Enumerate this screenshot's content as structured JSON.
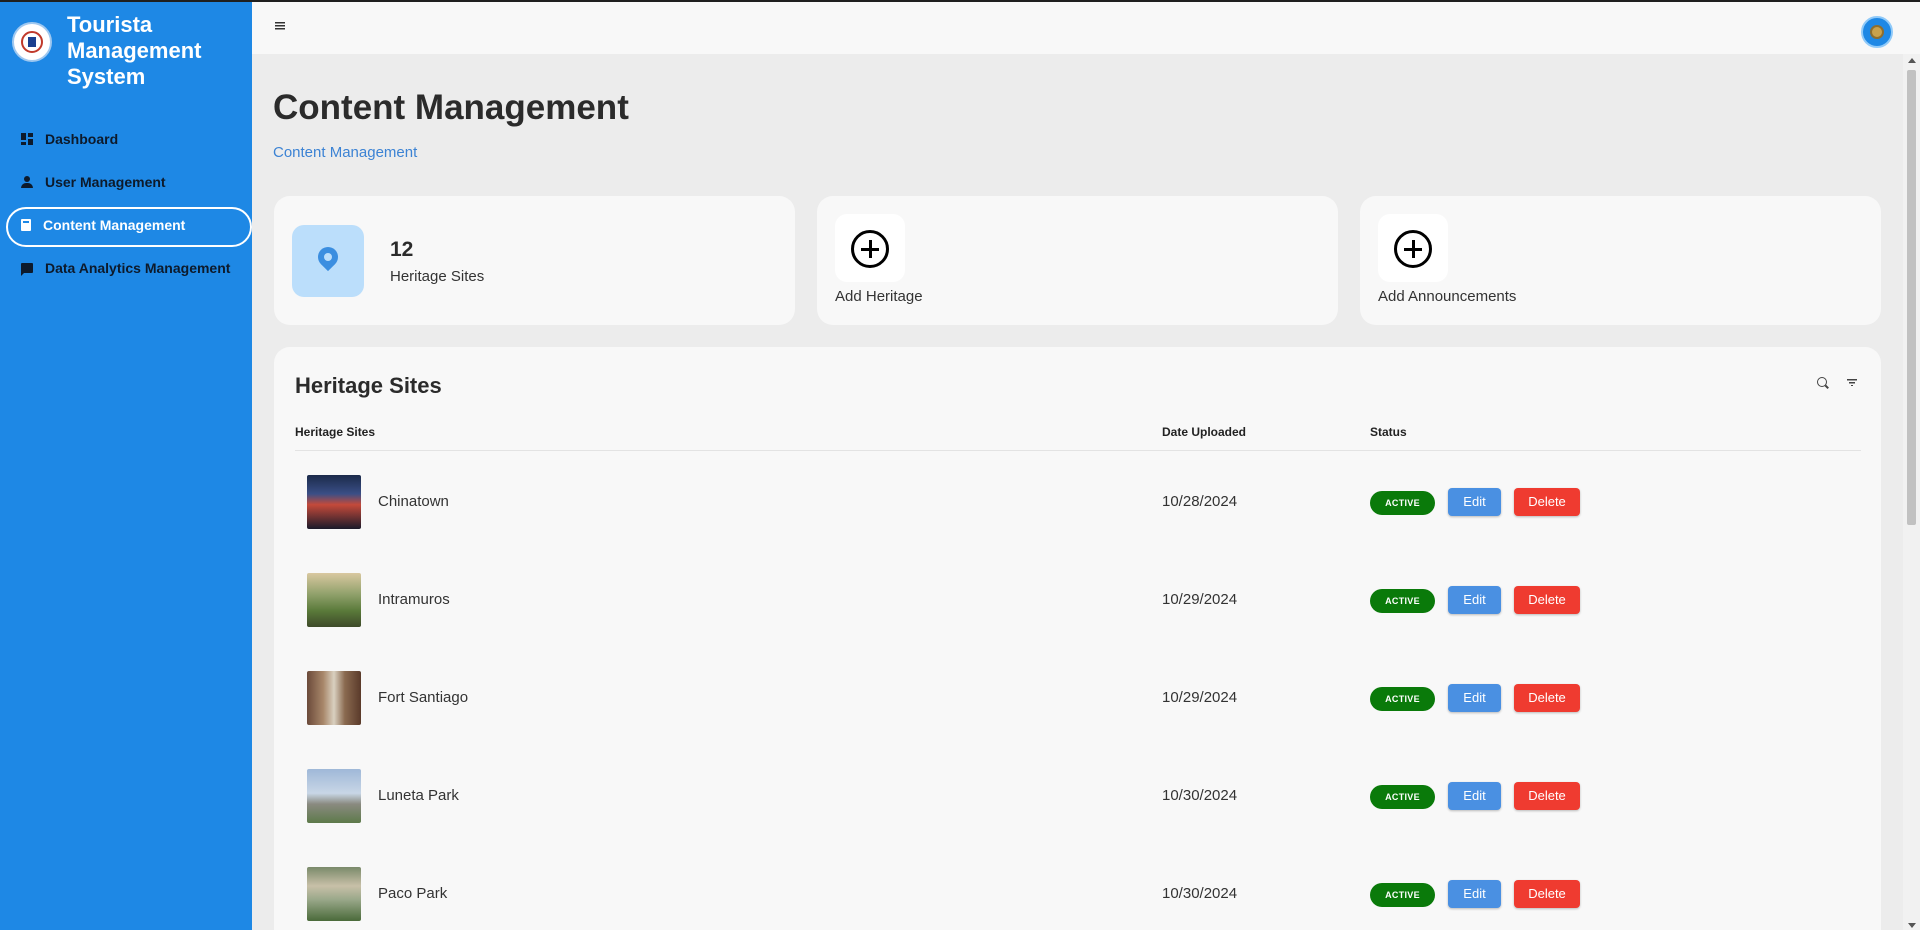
{
  "app": {
    "title": "Tourista Management System"
  },
  "sidebar": {
    "items": [
      {
        "label": "Dashboard",
        "icon": "dashboard-icon"
      },
      {
        "label": "User Management",
        "icon": "person-icon"
      },
      {
        "label": "Content Management",
        "icon": "book-icon",
        "active": true
      },
      {
        "label": "Data Analytics Management",
        "icon": "chat-icon"
      }
    ]
  },
  "header": {
    "menu_icon": "hamburger-menu-icon",
    "avatar_icon": "user-avatar"
  },
  "main": {
    "title": "Content Management",
    "breadcrumb": "Content Management",
    "cards": {
      "heritage_count": {
        "value": "12",
        "label": "Heritage Sites",
        "icon": "location-pin-icon"
      },
      "add_heritage": {
        "label": "Add Heritage",
        "icon": "plus-circle-icon"
      },
      "add_announcements": {
        "label": "Add Announcements",
        "icon": "plus-circle-icon"
      }
    },
    "table": {
      "title": "Heritage Sites",
      "columns": [
        "Heritage Sites",
        "Date Uploaded",
        "Status"
      ],
      "rows": [
        {
          "name": "Chinatown",
          "date": "10/28/2024",
          "status": "ACTIVE",
          "edit": "Edit",
          "delete": "Delete"
        },
        {
          "name": "Intramuros",
          "date": "10/29/2024",
          "status": "ACTIVE",
          "edit": "Edit",
          "delete": "Delete"
        },
        {
          "name": "Fort Santiago",
          "date": "10/29/2024",
          "status": "ACTIVE",
          "edit": "Edit",
          "delete": "Delete"
        },
        {
          "name": "Luneta Park",
          "date": "10/30/2024",
          "status": "ACTIVE",
          "edit": "Edit",
          "delete": "Delete"
        },
        {
          "name": "Paco Park",
          "date": "10/30/2024",
          "status": "ACTIVE",
          "edit": "Edit",
          "delete": "Delete"
        }
      ]
    }
  },
  "colors": {
    "sidebar": "#1e88e5",
    "active_badge": "#0a7a0a",
    "edit_button": "#4a90e2",
    "delete_button": "#ef3b30",
    "breadcrumb": "#3c83d4"
  }
}
